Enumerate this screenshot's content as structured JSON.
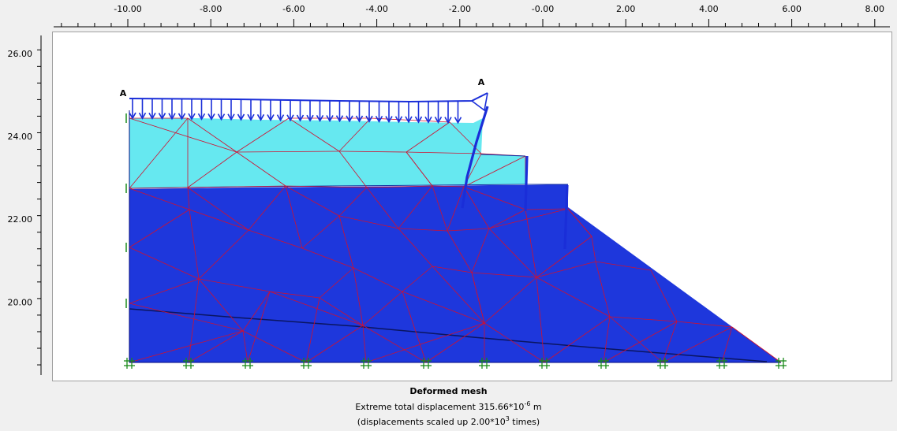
{
  "colors": {
    "background": "#f0f0f0",
    "soil_upper": "#66e8f0",
    "soil_lower": "#1e37dc",
    "mesh_lines": "#d01030",
    "structure": "#1a2ed8",
    "support": "#1a8a1a"
  },
  "axis": {
    "x_ticks": [
      "-10.00",
      "-8.00",
      "-6.00",
      "-4.00",
      "-2.00",
      "-0.00",
      "2.00",
      "4.00",
      "6.00",
      "8.00"
    ],
    "y_ticks": [
      "26.00",
      "24.00",
      "22.00",
      "20.00"
    ]
  },
  "section_labels": {
    "left": "A",
    "right": "A"
  },
  "caption": {
    "title": "Deformed mesh",
    "displacement_prefix": "Extreme total displacement 315.66*10",
    "displacement_exp": "-6",
    "displacement_unit": " m",
    "scale_prefix": "(displacements scaled up 2.00*10",
    "scale_exp": "3",
    "scale_suffix": " times)"
  }
}
